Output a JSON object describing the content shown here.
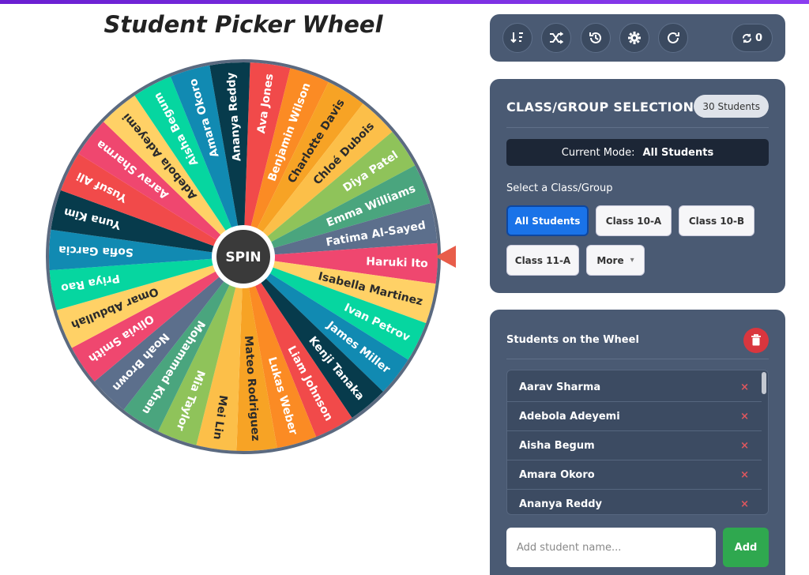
{
  "title": "Student Picker Wheel",
  "wheel": {
    "spin_label": "SPIN",
    "names": [
      "Ava Jones",
      "Benjamin Wilson",
      "Charlotte Davis",
      "Chloé Dubois",
      "Diya Patel",
      "Emma Williams",
      "Fatima Al-Sayed",
      "Haruki Ito",
      "Isabella Martinez",
      "Ivan Petrov",
      "James Miller",
      "Kenji Tanaka",
      "Liam Johnson",
      "Lukas Weber",
      "Mateo Rodriguez",
      "Mei Lin",
      "Mia Taylor",
      "Mohammed Khan",
      "Noah Brown",
      "Olivia Smith",
      "Omar Abdullah",
      "Priya Rao",
      "Sofia Garcia",
      "Yuna Kim",
      "Yusuf Ali",
      "Aarav Sharma",
      "Adebola Adeyemi",
      "Aisha Begum",
      "Amara Okoro",
      "Ananya Reddy"
    ],
    "colors": [
      "#f14a4a",
      "#fb8b24",
      "#f7a325",
      "#fcbf49",
      "#8fc35a",
      "#4aa57e",
      "#5c6f8c",
      "#ef476f",
      "#ffd166",
      "#06d6a0",
      "#118ab2",
      "#073b4c",
      "#f14a4a",
      "#fb8b24",
      "#f7a325",
      "#fcbf49",
      "#8fc35a",
      "#4aa57e",
      "#5c6f8c",
      "#ef476f",
      "#ffd166",
      "#06d6a0",
      "#118ab2",
      "#073b4c",
      "#f14a4a",
      "#ef476f",
      "#ffd166",
      "#06d6a0",
      "#118ab2",
      "#073b4c"
    ],
    "pointer_color": "#e85d4a"
  },
  "toolbar": {
    "icons": [
      "sort-icon",
      "shuffle-icon",
      "history-icon",
      "settings-icon",
      "reset-icon"
    ],
    "spin_count": "0"
  },
  "class_panel": {
    "heading": "CLASS/GROUP SELECTION",
    "count_badge": "30 Students",
    "mode_label": "Current Mode:",
    "mode_value": "All Students",
    "select_label": "Select a Class/Group",
    "buttons": [
      "All Students",
      "Class 10-A",
      "Class 10-B",
      "Class 11-A",
      "More"
    ],
    "more_caret": "▾"
  },
  "students_panel": {
    "heading": "Students on the Wheel",
    "rows": [
      "Aarav Sharma",
      "Adebola Adeyemi",
      "Aisha Begum",
      "Amara Okoro",
      "Ananya Reddy"
    ],
    "remove_glyph": "×",
    "add_placeholder": "Add student name...",
    "add_label": "Add"
  }
}
